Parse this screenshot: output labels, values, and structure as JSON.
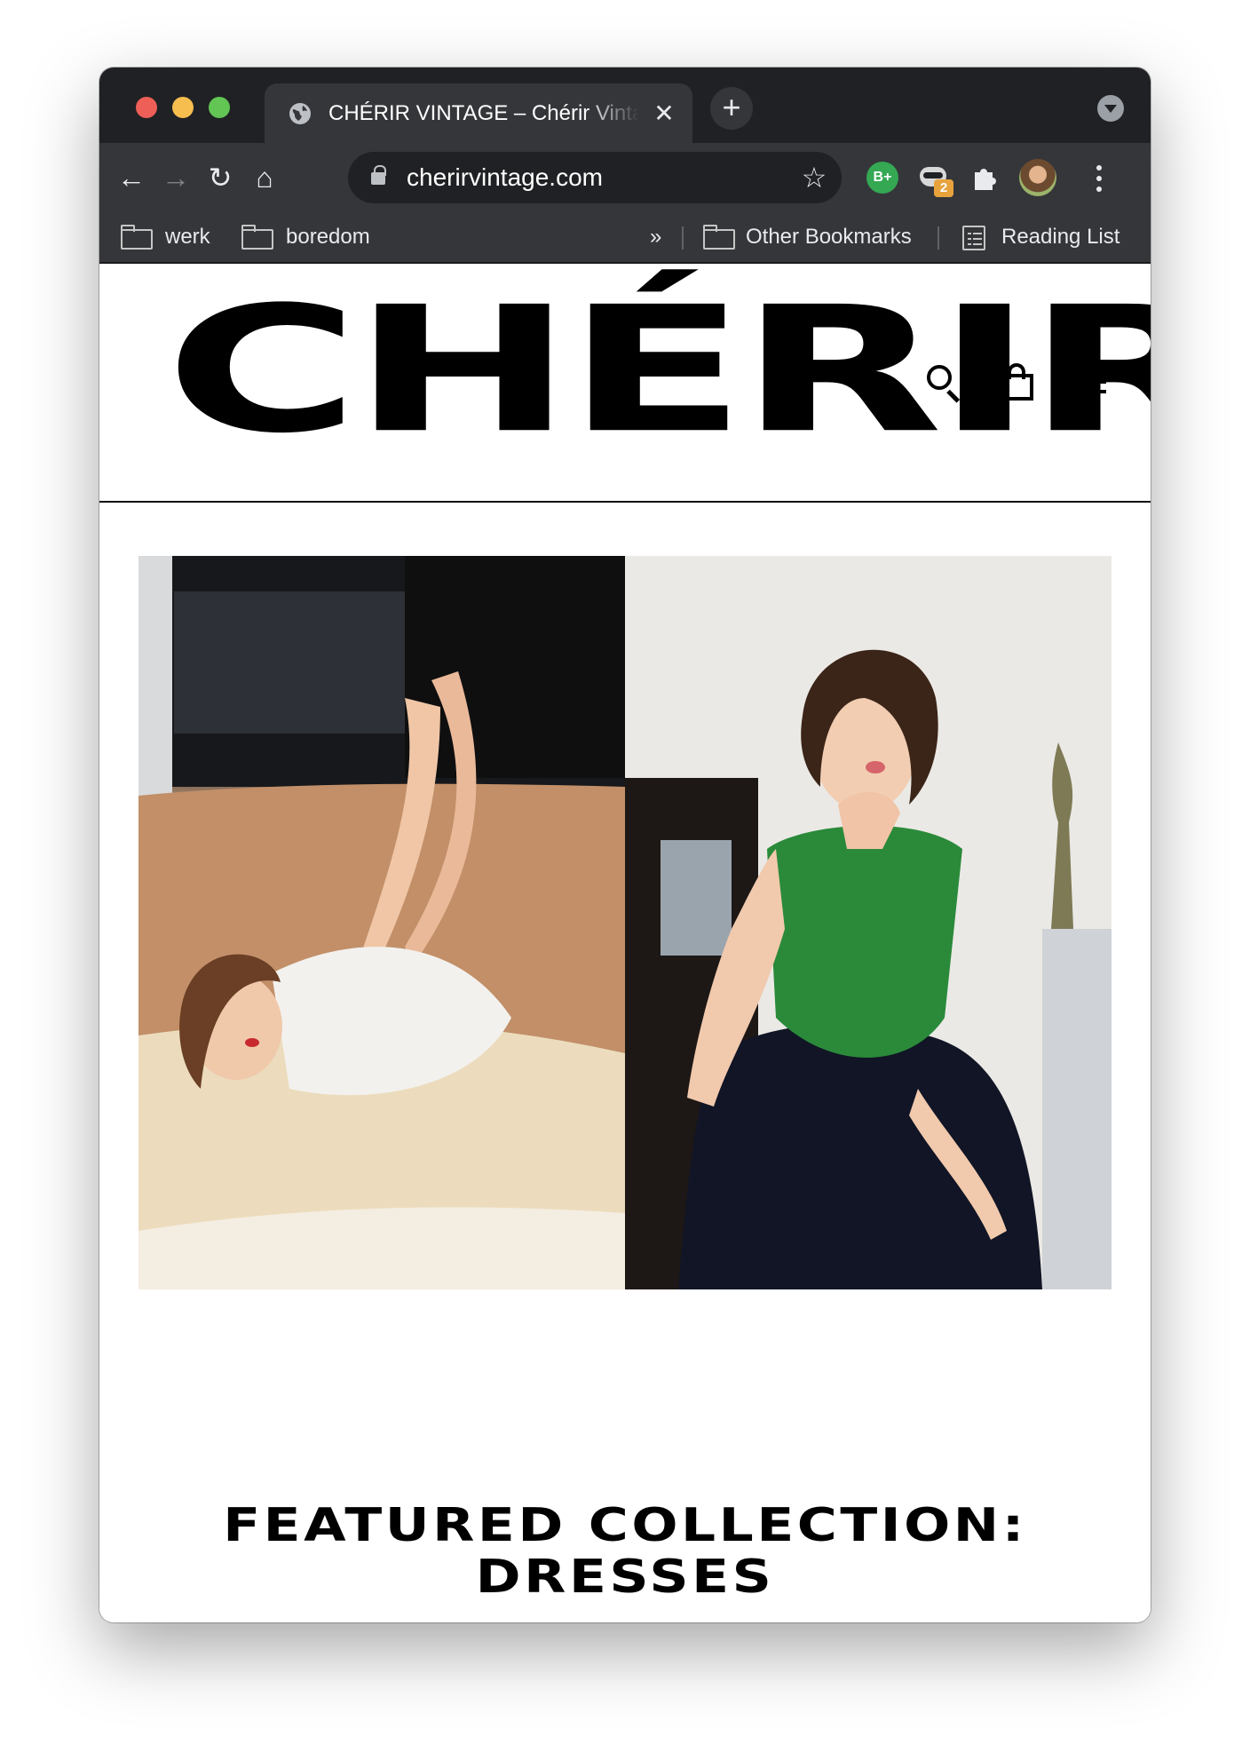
{
  "browser": {
    "tab": {
      "title": "CHÉRIR VINTAGE – Chérir Vintage",
      "close_glyph": "✕"
    },
    "new_tab_glyph": "+",
    "toolbar": {
      "back_glyph": "←",
      "forward_glyph": "→",
      "reload_glyph": "↻",
      "home_glyph": "⌂",
      "url": "cherirvintage.com",
      "bookmark_star_glyph": "☆"
    },
    "extensions": {
      "grammar_badge": "B+",
      "raccoon_badge_count": "2",
      "puzzle_glyph": "✦"
    },
    "bookmarks": {
      "items": [
        "werk",
        "boredom"
      ],
      "overflow_glyph": "»",
      "other_bookmarks": "Other Bookmarks",
      "reading_list": "Reading List"
    }
  },
  "site": {
    "logo": "CHÉRIR",
    "header_icons": [
      "search-icon",
      "shopping-bag-icon",
      "hamburger-menu-icon"
    ],
    "featured_title_line1": "FEATURED COLLECTION:",
    "featured_title_line2": "DRESSES"
  },
  "colors": {
    "chrome_dark": "#202124",
    "chrome_toolbar": "#35363a",
    "brand_text": "#000000",
    "grammar_green": "#34a853",
    "badge_orange": "#e8a33c"
  }
}
